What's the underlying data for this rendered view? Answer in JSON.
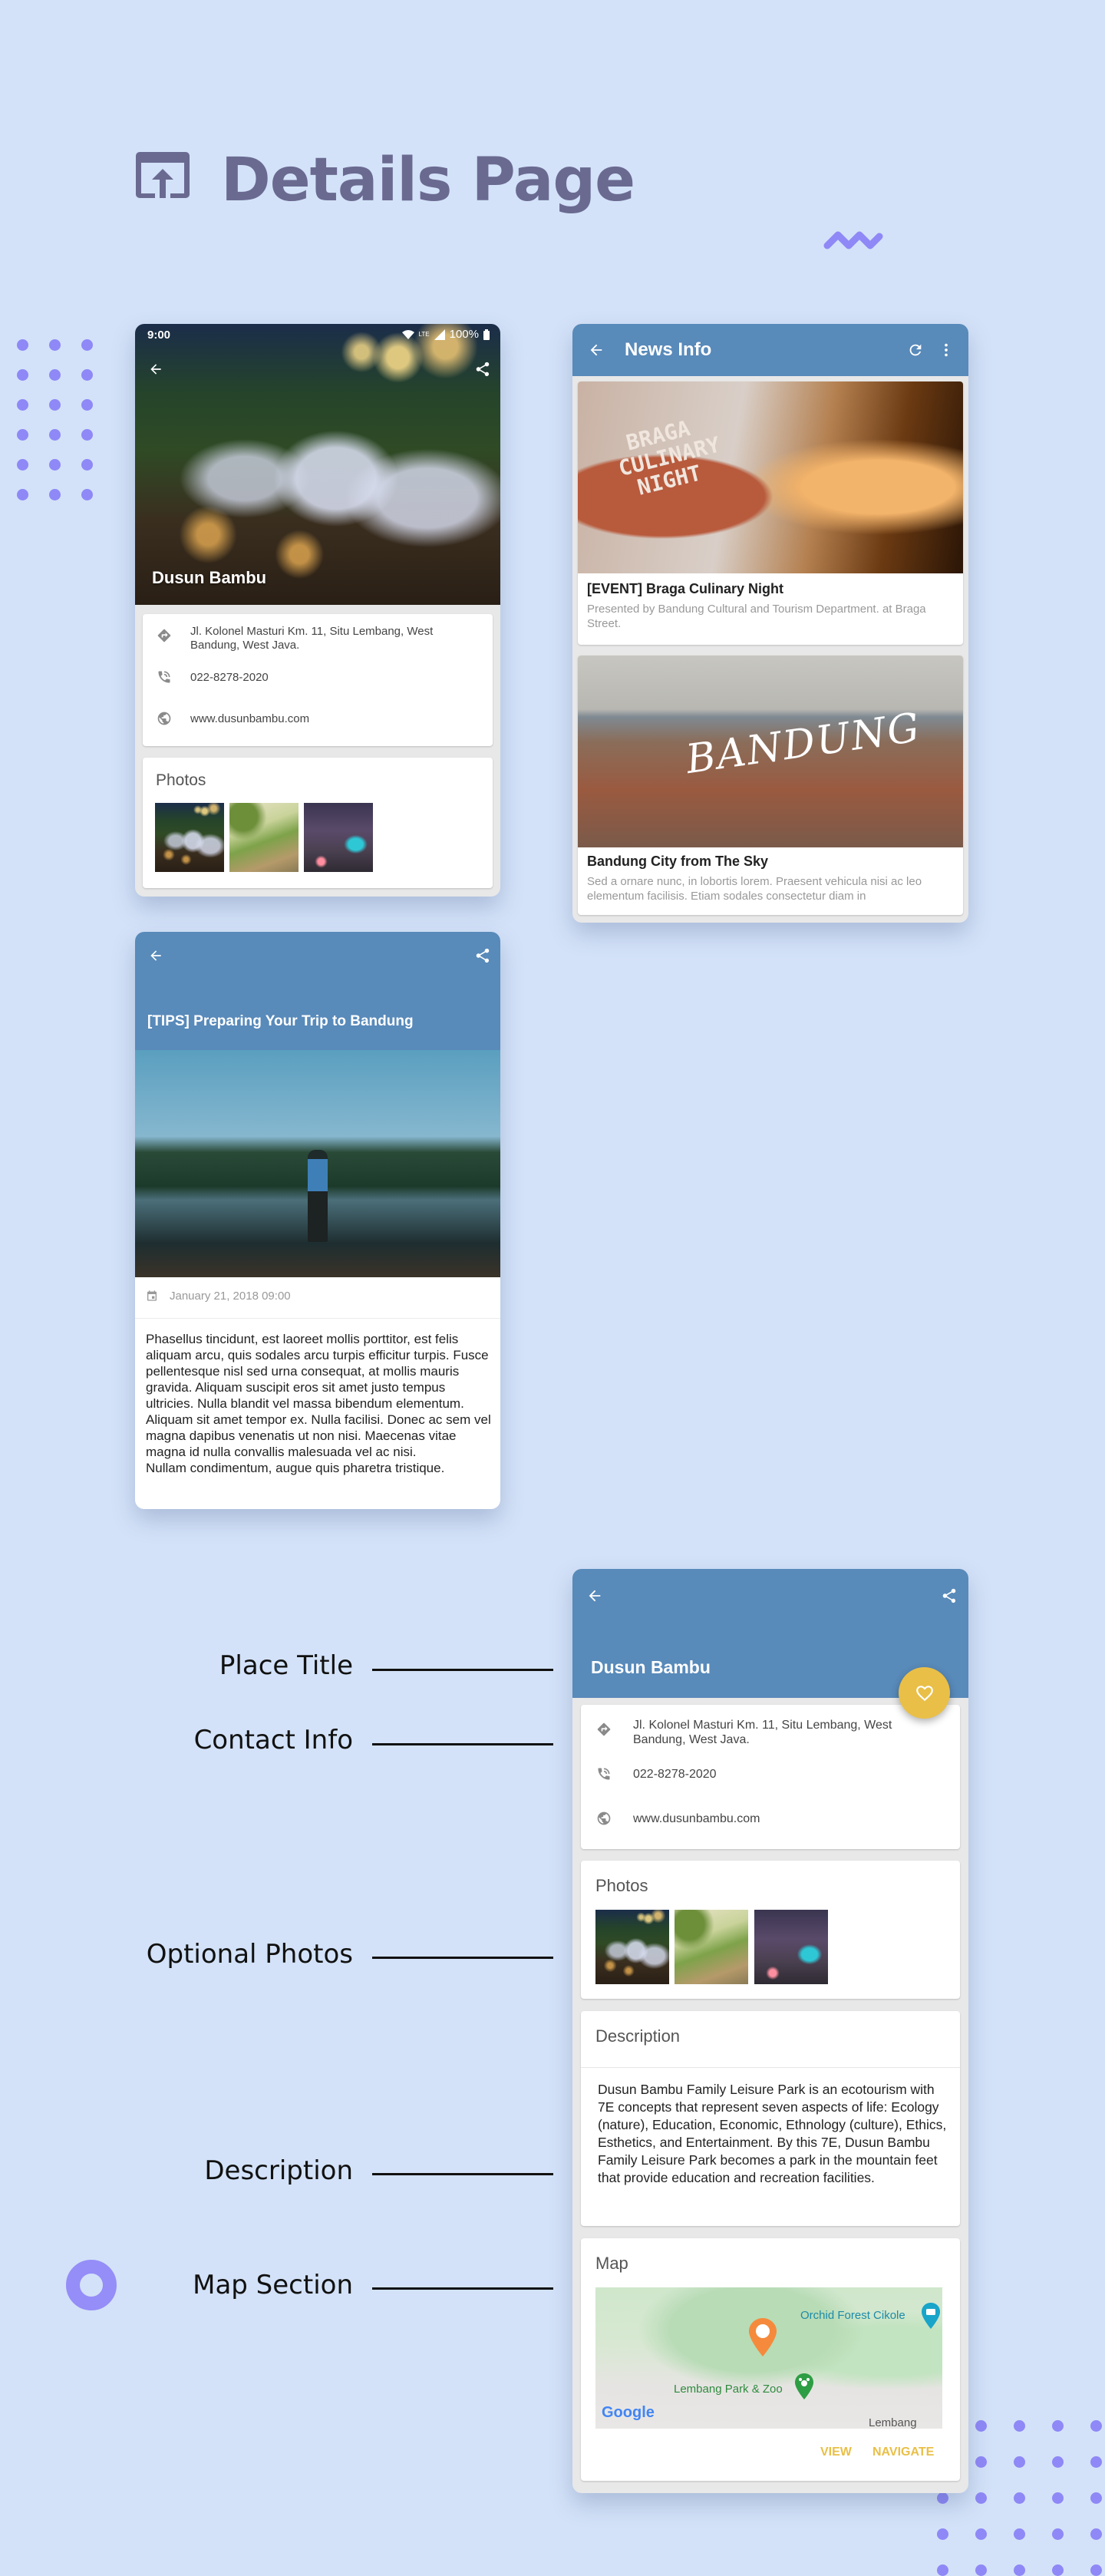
{
  "header": {
    "title": "Details Page",
    "icon": "open-in-browser-icon"
  },
  "colors": {
    "background": "#d3e2f8",
    "primary": "#588aba",
    "accent": "#e9bf47",
    "decor": "#8f88f7",
    "title": "#6a6a91"
  },
  "place_screen": {
    "status_bar": {
      "time": "9:00",
      "network": "LTE",
      "battery": "100%"
    },
    "title": "Dusun Bambu",
    "contact": {
      "address": "Jl. Kolonel Masturi Km. 11, Situ Lembang, West Bandung, West Java.",
      "phone": "022-8278-2020",
      "website": "www.dusunbambu.com"
    },
    "photos_heading": "Photos",
    "photos": [
      "Night terrace",
      "Rice field",
      "Camping"
    ]
  },
  "news_screen": {
    "title": "News Info",
    "items": [
      {
        "title": "[EVENT] Braga Culinary Night",
        "summary": "Presented by Bandung Cultural and Tourism Department. at Braga Street."
      },
      {
        "title": "Bandung City from The Sky",
        "summary": "Sed a ornare nunc, in lobortis lorem. Praesent vehicula nisi ac leo elementum facilisis. Etiam sodales consectetur diam in"
      }
    ]
  },
  "article_screen": {
    "title": "[TIPS] Preparing Your Trip to Bandung",
    "date": "January 21, 2018 09:00",
    "body": "Phasellus tincidunt, est laoreet mollis porttitor, est felis aliquam arcu, quis sodales arcu turpis efficitur turpis. Fusce pellentesque nisl sed urna consequat, at mollis mauris gravida. Aliquam suscipit eros sit amet justo tempus ultricies. Nulla blandit vel massa bibendum elementum. Aliquam sit amet tempor ex. Nulla facilisi. Donec ac sem vel magna dapibus venenatis ut non nisi. Maecenas vitae magna id nulla convallis malesuada vel ac nisi.\nNullam condimentum, augue quis pharetra tristique."
  },
  "detail_screen": {
    "title": "Dusun Bambu",
    "contact": {
      "address": "Jl. Kolonel Masturi Km. 11, Situ Lembang, West Bandung, West Java.",
      "phone": "022-8278-2020",
      "website": "www.dusunbambu.com"
    },
    "photos_heading": "Photos",
    "description_heading": "Description",
    "description": "Dusun Bambu Family Leisure Park is an ecotourism with 7E concepts that represent seven aspects of life: Ecology (nature), Education, Economic, Ethnology (culture), Ethics, Esthetics, and Entertainment. By this 7E, Dusun Bambu Family Leisure Park becomes a park in the mountain feet that provide education and recreation facilities.",
    "map_heading": "Map",
    "map_labels": {
      "poi_1": "Orchid Forest Cikole",
      "poi_2": "Lembang Park & Zoo",
      "town": "Lembang",
      "attribution": "Google"
    },
    "actions": {
      "view": "VIEW",
      "navigate": "NAVIGATE"
    }
  },
  "annotations": {
    "place_title": "Place Title",
    "contact_info": "Contact Info",
    "optional_photos": "Optional Photos",
    "description": "Description",
    "map_section": "Map Section"
  }
}
